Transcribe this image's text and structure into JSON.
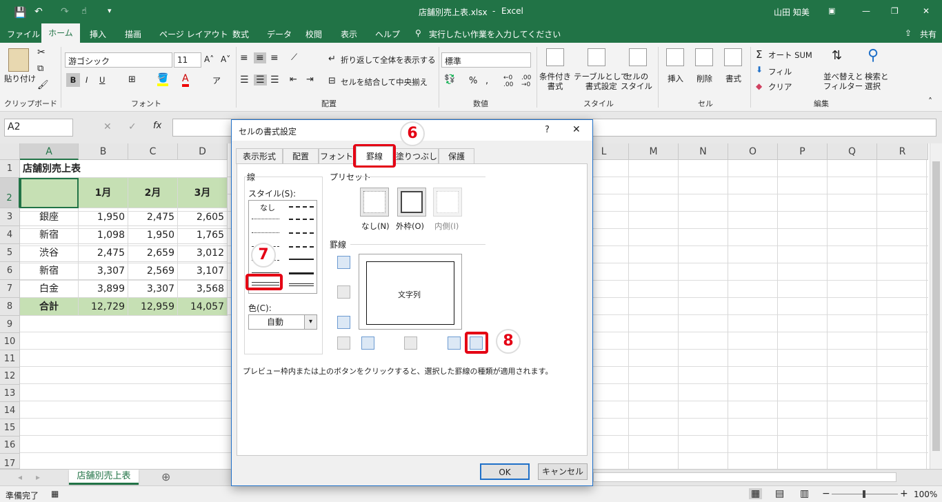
{
  "titlebar": {
    "filename": "店舗別売上表.xlsx",
    "sep": "-",
    "app": "Excel",
    "user": "山田 知美"
  },
  "menu": [
    "ファイル",
    "ホーム",
    "挿入",
    "描画",
    "ページ レイアウト",
    "数式",
    "データ",
    "校閲",
    "表示",
    "ヘルプ"
  ],
  "menu_search": "実行したい作業を入力してください",
  "share": "共有",
  "ribbon": {
    "paste": "貼り付け",
    "clipboard": "クリップボード",
    "font_name": "游ゴシック",
    "font_size": "11",
    "font": "フォント",
    "bold": "B",
    "italic": "I",
    "underline": "U",
    "wrap": "折り返して全体を表示する",
    "merge": "セルを結合して中央揃え",
    "alignment": "配置",
    "number_format": "標準",
    "number": "数値",
    "percent": "%",
    "cond_format": [
      "条件付き",
      "書式"
    ],
    "table_format": [
      "テーブルとして",
      "書式設定"
    ],
    "cell_style": [
      "セルの",
      "スタイル"
    ],
    "styles": "スタイル",
    "insert": "挿入",
    "delete": "削除",
    "format": "書式",
    "cells": "セル",
    "autosum": "オート SUM",
    "fill": "フィル",
    "clear": "クリア",
    "sort": [
      "並べ替えと",
      "フィルター"
    ],
    "find": [
      "検索と",
      "選択"
    ],
    "editing": "編集"
  },
  "namebox": "A2",
  "fx": "fx",
  "columns": [
    "A",
    "B",
    "C",
    "D",
    "L",
    "M",
    "N",
    "O",
    "P",
    "Q",
    "R"
  ],
  "rows": [
    "1",
    "2",
    "3",
    "4",
    "5",
    "6",
    "7",
    "8",
    "9",
    "10",
    "11",
    "12",
    "13",
    "14",
    "15",
    "16",
    "17"
  ],
  "cells": {
    "title": "店舗別売上表",
    "headers": [
      "1月",
      "2月",
      "3月"
    ],
    "data": [
      [
        "銀座",
        "1,950",
        "2,475",
        "2,605"
      ],
      [
        "新宿",
        "1,098",
        "1,950",
        "1,765"
      ],
      [
        "渋谷",
        "2,475",
        "2,659",
        "3,012"
      ],
      [
        "新宿",
        "3,307",
        "2,569",
        "3,107"
      ],
      [
        "白金",
        "3,899",
        "3,307",
        "3,568"
      ]
    ],
    "total": [
      "合計",
      "12,729",
      "12,959",
      "14,057"
    ]
  },
  "sheet_tab": "店舗別売上表",
  "status": {
    "ready": "準備完了",
    "zoom": "100%"
  },
  "dialog": {
    "title": "セルの書式設定",
    "help": "?",
    "close": "✕",
    "tabs": [
      "表示形式",
      "配置",
      "フォント",
      "罫線",
      "塗りつぶし",
      "保護"
    ],
    "line_group": "線",
    "style_label": "スタイル(S):",
    "none": "なし",
    "color_label": "色(C):",
    "color_value": "自動",
    "preset_group": "プリセット",
    "preset_none": "なし(N)",
    "preset_outline": "外枠(O)",
    "preset_inside": "内側(I)",
    "border_group": "罫線",
    "preview_text": "文字列",
    "hint": "プレビュー枠内または上のボタンをクリックすると、選択した罫線の種類が適用されます。",
    "ok": "OK",
    "cancel": "キャンセル"
  },
  "annotations": {
    "six": "6",
    "seven": "7",
    "eight": "8"
  },
  "colors": {
    "excel_green": "#217346",
    "header_fill": "#c6e0b4",
    "annotation_red": "#e40014"
  }
}
